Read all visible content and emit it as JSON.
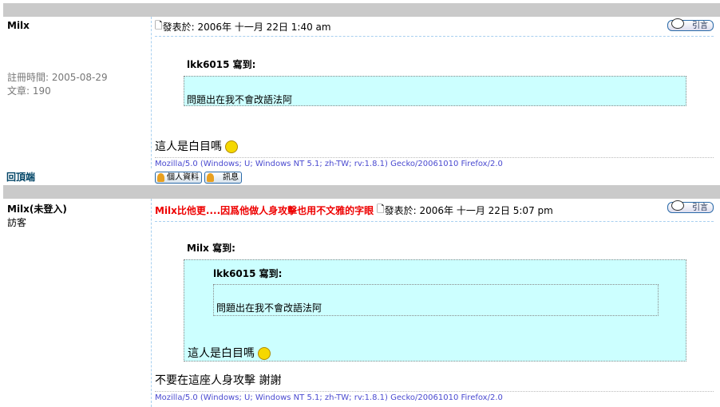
{
  "posts": [
    {
      "author": "Milx",
      "reg": "註冊時間: 2005-08-29",
      "count": "文章: 190",
      "posted": "發表於: 2006年 十一月 22日 1:40 am",
      "quote_btn": "引言",
      "quote_author": "lkk6015 寫到:",
      "quote_text": "問題出在我不會改語法阿",
      "body": "這人是白目嗎",
      "sig": "Mozilla/5.0 (Windows; U; Windows NT 5.1; zh-TW; rv:1.8.1) Gecko/20061010 Firefox/2.0",
      "profile_btn": "個人資料",
      "pm_btn": "訊息"
    },
    {
      "author": "Milx(未登入)",
      "role": "訪客",
      "title": "Milx比他更....因爲他做人身攻擊也用不文雅的字眼",
      "posted": "發表於: 2006年 十一月 22日 5:07 pm",
      "quote_btn": "引言",
      "quote_author": "Milx 寫到:",
      "inner_quote_author": "lkk6015 寫到:",
      "inner_quote_text": "問題出在我不會改語法阿",
      "quote_text": "這人是白目嗎",
      "body": "不要在這座人身攻擊 謝謝",
      "sig": "Mozilla/5.0 (Windows; U; Windows NT 5.1; zh-TW; rv:1.8.1) Gecko/20061010 Firefox/2.0"
    }
  ],
  "back_to_top": "回頂端"
}
